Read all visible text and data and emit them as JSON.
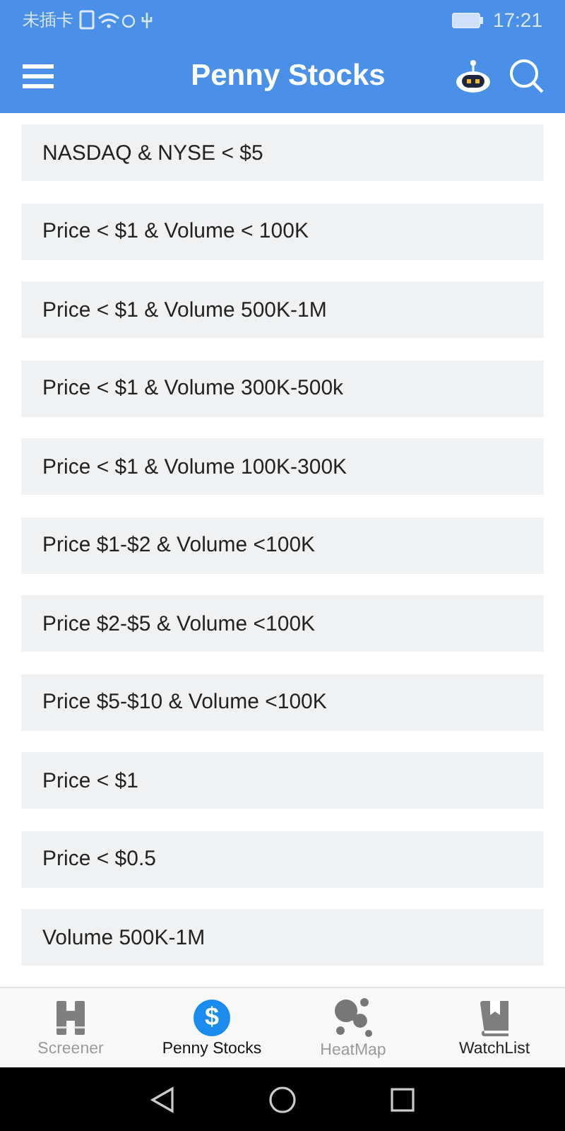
{
  "status_bar": {
    "carrier": "未插卡",
    "time": "17:21"
  },
  "header": {
    "title": "Penny Stocks"
  },
  "screens": [
    {
      "label": "NASDAQ & NYSE < $5"
    },
    {
      "label": "Price < $1 & Volume < 100K"
    },
    {
      "label": "Price < $1 & Volume 500K-1M"
    },
    {
      "label": "Price < $1 & Volume 300K-500k"
    },
    {
      "label": "Price < $1 & Volume 100K-300K"
    },
    {
      "label": "Price $1-$2 & Volume <100K"
    },
    {
      "label": "Price $2-$5 & Volume <100K"
    },
    {
      "label": "Price $5-$10 & Volume <100K"
    },
    {
      "label": "Price < $1"
    },
    {
      "label": "Price < $0.5"
    },
    {
      "label": "Volume 500K-1M"
    }
  ],
  "tabs": [
    {
      "label": "Screener",
      "kind": "binoculars",
      "selected": false,
      "disabled": true
    },
    {
      "label": "Penny Stocks",
      "kind": "dollar",
      "glyph": "$",
      "selected": true,
      "disabled": false
    },
    {
      "label": "HeatMap",
      "kind": "bubbles",
      "selected": false,
      "disabled": true
    },
    {
      "label": "WatchList",
      "kind": "book",
      "selected": false,
      "disabled": false
    }
  ]
}
